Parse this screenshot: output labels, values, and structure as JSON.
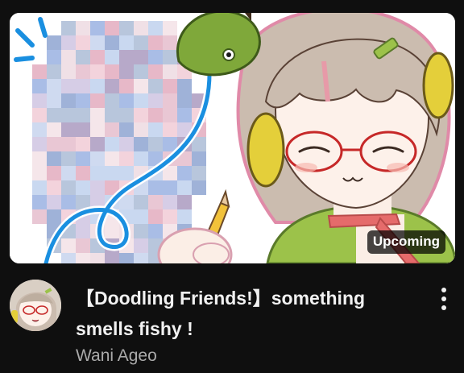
{
  "video": {
    "badge": "Upcoming",
    "title": "【Doodling Friends!】something smells fishy !",
    "channel": "Wani Ageo"
  },
  "icons": {
    "more": "kebab-vertical-icon"
  },
  "colors": {
    "background": "#0f0f0f",
    "title_text": "#f1f1f1",
    "channel_text": "#aaaaaa",
    "badge_bg": "#000000b8"
  }
}
